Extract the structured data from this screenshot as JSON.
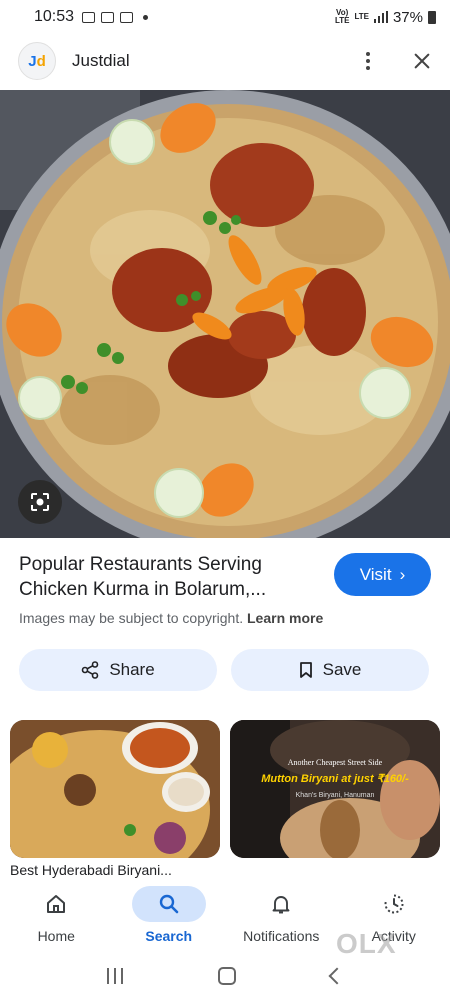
{
  "status_bar": {
    "time": "10:53",
    "network_top": "Vo)",
    "network_bottom": "LTE",
    "lte": "LTE",
    "battery": "37%"
  },
  "header": {
    "logo_letters": [
      "J",
      "d"
    ],
    "title": "Justdial"
  },
  "result": {
    "title": "Popular Restaurants Serving Chicken Kurma in Bolarum,...",
    "visit_label": "Visit",
    "copyright_text": "Images may be subject to copyright.",
    "learn_more": "Learn more",
    "share_label": "Share",
    "save_label": "Save"
  },
  "related": {
    "caption_1": "Best Hyderabadi Biryani...",
    "overlay_2_line1": "Another Cheapest Street Side",
    "overlay_2_line2": "Mutton Biryani at just ₹160/-",
    "overlay_2_line3": "Khan's Biryani, Hanuman"
  },
  "bottom_nav": {
    "items": [
      {
        "label": "Home",
        "icon": "home-icon"
      },
      {
        "label": "Search",
        "icon": "search-icon",
        "active": true
      },
      {
        "label": "Notifications",
        "icon": "bell-icon"
      },
      {
        "label": "Activity",
        "icon": "activity-icon"
      }
    ]
  },
  "watermark": "OLX",
  "colors": {
    "accent": "#1a73e8",
    "chip_bg": "#e8f0fe",
    "active_pill": "#d2e3fc"
  }
}
